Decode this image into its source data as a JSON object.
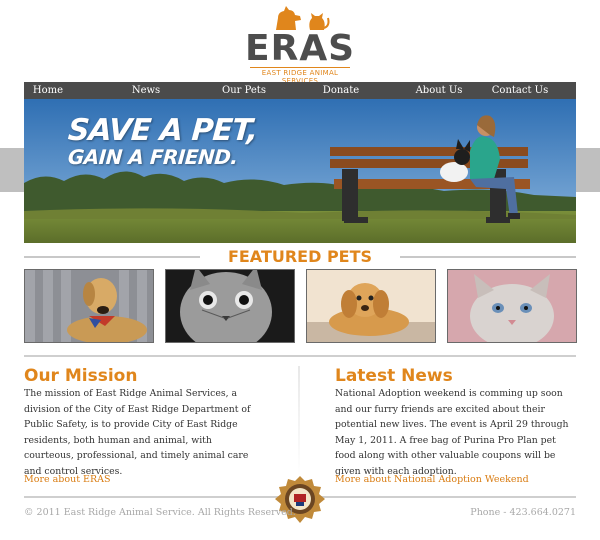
{
  "logo": {
    "wordmark": "ERAS",
    "subtitle": "EAST RIDGE ANIMAL SERVICES"
  },
  "nav": {
    "items": [
      {
        "label": "Home"
      },
      {
        "label": "News"
      },
      {
        "label": "Our Pets"
      },
      {
        "label": "Donate"
      },
      {
        "label": "About Us"
      },
      {
        "label": "Contact Us"
      }
    ]
  },
  "hero": {
    "line1": "SAVE A PET,",
    "line2": "GAIN A FRIEND."
  },
  "featured": {
    "title": "FEATURED PETS",
    "pets": [
      {
        "icon": "dog-photo"
      },
      {
        "icon": "cat-photo"
      },
      {
        "icon": "puppy-photo"
      },
      {
        "icon": "kitten-photo"
      }
    ]
  },
  "mission": {
    "title": "Our Mission",
    "body": "The mission of East Ridge Animal Services, a division of the City of East Ridge Department of Public Safety, is to provide City of East Ridge residents, both human and animal, with courteous, professional, and timely animal care and control services.",
    "link": "More about ERAS"
  },
  "news": {
    "title": "Latest News",
    "body": "National Adoption weekend is comming up soon and our furry friends are excited about their potential new lives. The event is April 29 through May 1, 2011. A free bag of Purina Pro Plan pet food along with other valuable coupons will be given with each adoption.",
    "link": "More about National Adoption Weekend"
  },
  "footer": {
    "copyright": "© 2011 East Ridge Animal Service. All Rights Reserved.",
    "phone": "Phone - 423.664.0271"
  },
  "colors": {
    "accent": "#e0861c",
    "nav_bg": "#4b4b4b",
    "sky": "#4f86c6"
  }
}
